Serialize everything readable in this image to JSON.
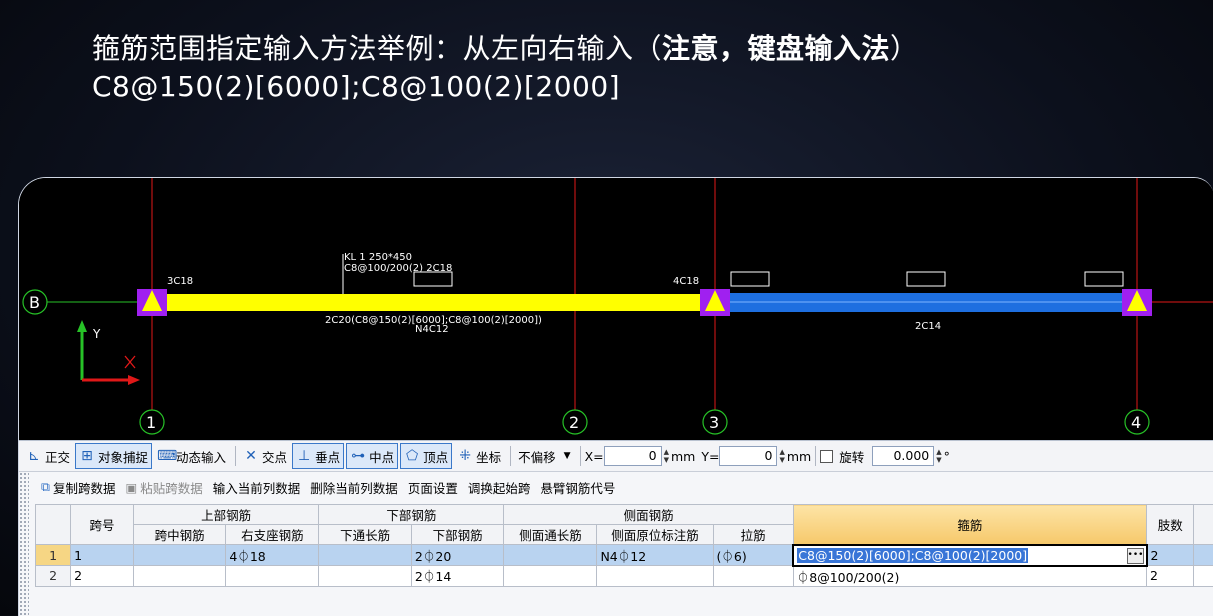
{
  "headline": {
    "line1_prefix": "箍筋范围指定输入方法举例：从左向右输入（",
    "line1_bold": "注意，键盘输入法",
    "line1_suffix": "）",
    "line2": "C8@150(2)[6000];C8@100(2)[2000]"
  },
  "cad": {
    "axis_label_B": "B",
    "axis_numbers": [
      "1",
      "2",
      "3",
      "4"
    ],
    "label_3c18": "3C18",
    "label_4c18": "4C18",
    "beam_title_1": "KL 1 250*450",
    "beam_title_2": "C8@100/200(2) 2C18",
    "span1_bottom_1": "2C20(C8@150(2)[6000];C8@100(2)[2000])",
    "span1_bottom_2": "N4C12",
    "span2_bottom": "2C14",
    "ucs_y": "Y",
    "ucs_x": "X",
    "colors": {
      "yellow_beam": "#ffff00",
      "blue_beam": "#1e6fe0",
      "support": "#a020f0",
      "axis_line": "#e01818",
      "axis_circle": "#27c227"
    }
  },
  "toolbar": {
    "ortho": "正交",
    "snap": "对象捕捉",
    "dynamic": "动态输入",
    "intersection": "交点",
    "perpendicular": "垂点",
    "midpoint": "中点",
    "vertex": "顶点",
    "coordinate": "坐标",
    "offset_select": "不偏移",
    "x_label": "X=",
    "x_value": "0",
    "mm1": "mm",
    "y_label": "Y=",
    "y_value": "0",
    "mm2": "mm",
    "rotate_label": "旋转",
    "rotate_value": "0.000",
    "degree": "°"
  },
  "panel_toolbar": {
    "copy_span": "复制跨数据",
    "paste_span": "粘贴跨数据",
    "input_column": "输入当前列数据",
    "delete_column": "删除当前列数据",
    "page_setup": "页面设置",
    "swap_start": "调换起始跨",
    "cantilever_code": "悬臂钢筋代号"
  },
  "table": {
    "header_top": {
      "span_no": "跨号",
      "top_rebar": "上部钢筋",
      "bottom_rebar": "下部钢筋",
      "side_rebar": "侧面钢筋",
      "stirrup": "箍筋",
      "legs": "肢数"
    },
    "header_sub": {
      "mid_span": "跨中钢筋",
      "right_support": "右支座钢筋",
      "bottom_through": "下通长筋",
      "bottom_rebar": "下部钢筋",
      "side_through": "侧面通长筋",
      "side_original": "侧面原位标注筋",
      "tie": "拉筋"
    },
    "rows": [
      {
        "idx": "1",
        "span": "1",
        "mid": "",
        "right_support": "4⏀18",
        "bottom_through": "",
        "bottom": "2⏀20",
        "side_through": "",
        "side_original": "N4⏀12",
        "tie": "(⏀6)",
        "stirrup": "C8@150(2)[6000];C8@100(2)[2000]",
        "legs": "2"
      },
      {
        "idx": "2",
        "span": "2",
        "mid": "",
        "right_support": "",
        "bottom_through": "",
        "bottom": "2⏀14",
        "side_through": "",
        "side_original": "",
        "tie": "",
        "stirrup": "⏀8@100/200(2)",
        "legs": "2"
      }
    ]
  }
}
